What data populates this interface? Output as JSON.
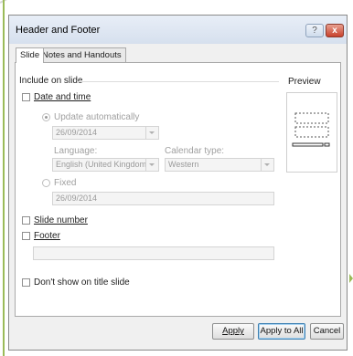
{
  "window": {
    "title": "Header and Footer"
  },
  "tabs": [
    {
      "label": "Slide",
      "active": true
    },
    {
      "label": "Notes and Handouts",
      "active": false
    }
  ],
  "include_group": {
    "label": "Include on slide"
  },
  "date_time": {
    "label": "Date and time",
    "checked": false,
    "update_auto": {
      "label": "Update automatically",
      "selected": true,
      "value": "26/09/2014"
    },
    "language": {
      "label": "Language:",
      "value": "English (United Kingdom)"
    },
    "calendar": {
      "label": "Calendar type:",
      "value": "Western"
    },
    "fixed": {
      "label": "Fixed",
      "selected": false,
      "value": "26/09/2014"
    }
  },
  "slide_number": {
    "label": "Slide number",
    "checked": false
  },
  "footer": {
    "label": "Footer",
    "checked": false,
    "value": ""
  },
  "dont_show": {
    "label": "Don't show on title slide",
    "checked": false
  },
  "preview": {
    "label": "Preview"
  },
  "buttons": {
    "apply": "Apply",
    "apply_all": "Apply to All",
    "cancel": "Cancel"
  },
  "title_buttons": {
    "help": "?",
    "close": "x"
  }
}
